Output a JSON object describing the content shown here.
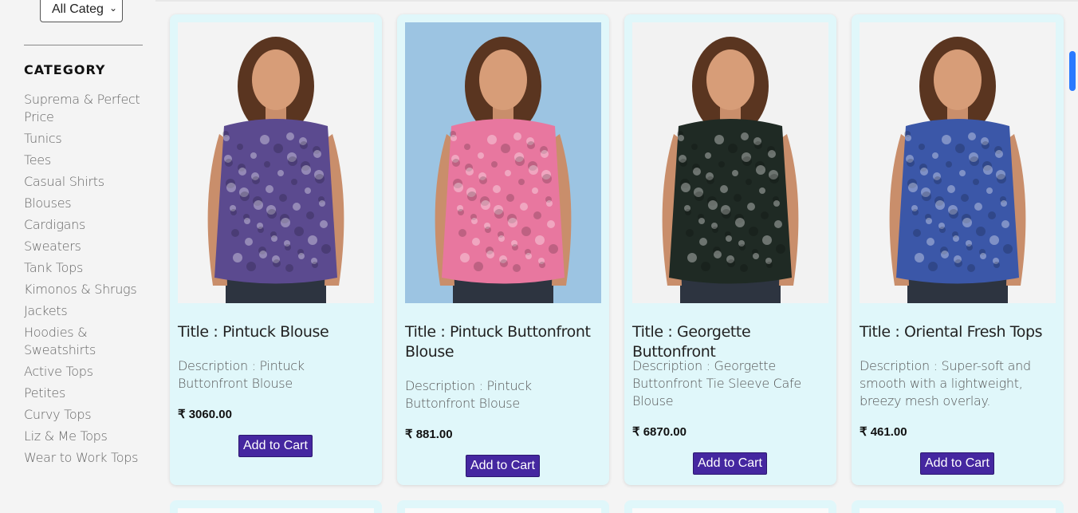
{
  "filter": {
    "selected": "All Categ"
  },
  "sidebar": {
    "heading": "CATEGORY",
    "items": [
      "Suprema & Perfect Price",
      "Tunics",
      "Tees",
      "Casual Shirts",
      "Blouses",
      "Cardigans",
      "Sweaters",
      "Tank Tops",
      "Kimonos & Shrugs",
      "Jackets",
      "Hoodies & Sweatshirts",
      "Active Tops",
      "Petites",
      "Curvy Tops",
      "Liz & Me Tops",
      "Wear to Work Tops"
    ]
  },
  "products": [
    {
      "title": "Title : Pintuck Blouse",
      "description": "Description : Pintuck Buttonfront Blouse",
      "price": "₹ 3060.00",
      "button": "Add to Cart",
      "pattern": "purple paisley",
      "shirt_color": "#5b4a8f",
      "bg_color": "#f3f3f3"
    },
    {
      "title": "Title : Pintuck Buttonfront Blouse",
      "description": "Description : Pintuck Buttonfront Blouse",
      "price": "₹ 881.00",
      "button": "Add to Cart",
      "pattern": "pink floral",
      "shirt_color": "#e8779f",
      "bg_color": "#9cc4e2"
    },
    {
      "title": "Title : Georgette Buttonfront",
      "description": "Description : Georgette Buttonfront Tie Sleeve Cafe Blouse",
      "price": "₹ 6870.00",
      "button": "Add to Cart",
      "pattern": "black floral",
      "shirt_color": "#1f2a24",
      "bg_color": "#f2f2f2"
    },
    {
      "title": "Title : Oriental Fresh Tops",
      "description": "Description : Super-soft and smooth with a lightweight, breezy mesh overlay.",
      "price": "₹ 461.00",
      "button": "Add to Cart",
      "pattern": "blue leaf print",
      "shirt_color": "#3b57a8",
      "bg_color": "#f3f3f3"
    }
  ],
  "colors": {
    "card_bg": "#e0f7fa",
    "button": "#4527a0",
    "accent_scroll": "#2979ff"
  }
}
